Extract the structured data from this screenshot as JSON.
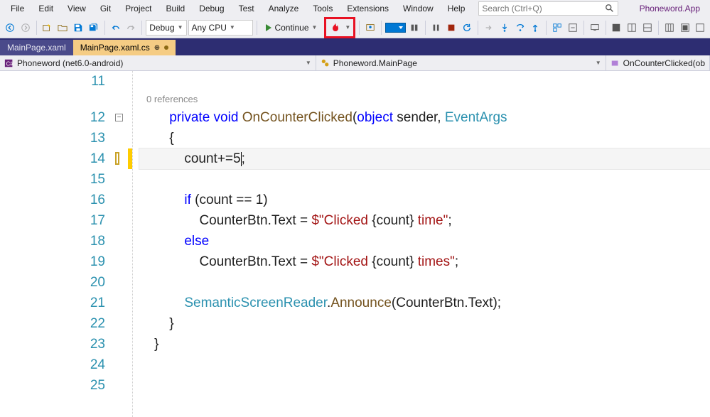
{
  "menu": {
    "items": [
      "File",
      "Edit",
      "View",
      "Git",
      "Project",
      "Build",
      "Debug",
      "Test",
      "Analyze",
      "Tools",
      "Extensions",
      "Window",
      "Help"
    ]
  },
  "search": {
    "placeholder": "Search (Ctrl+Q)"
  },
  "project_name": "Phoneword.App",
  "toolbar": {
    "config": "Debug",
    "platform": "Any CPU",
    "continue_label": "Continue"
  },
  "tabs": [
    {
      "label": "MainPage.xaml",
      "active": false
    },
    {
      "label": "MainPage.xaml.cs",
      "active": true
    }
  ],
  "nav": {
    "project": "Phoneword (net6.0-android)",
    "class": "Phoneword.MainPage",
    "member": "OnCounterClicked(ob"
  },
  "editor": {
    "references_label": "0 references",
    "lines": [
      {
        "n": 11,
        "txt": ""
      },
      {
        "n": 12,
        "txt": "        private void OnCounterClicked(object sender, EventArgs",
        "type": "sig"
      },
      {
        "n": 13,
        "txt": "        {"
      },
      {
        "n": 14,
        "txt": "            count+=5;",
        "cursor_after": "5"
      },
      {
        "n": 15,
        "txt": ""
      },
      {
        "n": 16,
        "txt": "            if (count == 1)"
      },
      {
        "n": 17,
        "txt": "                CounterBtn.Text = $\"Clicked {count} time\";"
      },
      {
        "n": 18,
        "txt": "            else"
      },
      {
        "n": 19,
        "txt": "                CounterBtn.Text = $\"Clicked {count} times\";"
      },
      {
        "n": 20,
        "txt": ""
      },
      {
        "n": 21,
        "txt": "            SemanticScreenReader.Announce(CounterBtn.Text);"
      },
      {
        "n": 22,
        "txt": "        }"
      },
      {
        "n": 23,
        "txt": "    }"
      },
      {
        "n": 24,
        "txt": ""
      },
      {
        "n": 25,
        "txt": ""
      }
    ]
  }
}
